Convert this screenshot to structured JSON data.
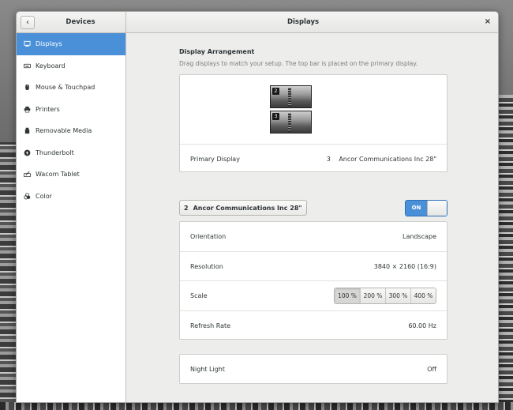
{
  "sidebar": {
    "title": "Devices",
    "back_label": "‹",
    "items": [
      {
        "label": "Displays",
        "icon": "display-icon",
        "active": true
      },
      {
        "label": "Keyboard",
        "icon": "keyboard-icon"
      },
      {
        "label": "Mouse & Touchpad",
        "icon": "mouse-icon"
      },
      {
        "label": "Printers",
        "icon": "printer-icon"
      },
      {
        "label": "Removable Media",
        "icon": "removable-media-icon"
      },
      {
        "label": "Thunderbolt",
        "icon": "thunderbolt-icon"
      },
      {
        "label": "Wacom Tablet",
        "icon": "tablet-icon"
      },
      {
        "label": "Color",
        "icon": "color-icon"
      }
    ]
  },
  "header": {
    "title": "Displays",
    "close_label": "×"
  },
  "arrangement": {
    "title": "Display Arrangement",
    "subtitle": "Drag displays to match your setup. The top bar is placed on the primary display.",
    "monitors": [
      {
        "number": "2"
      },
      {
        "number": "3"
      }
    ],
    "primary_label": "Primary Display",
    "primary_number": "3",
    "primary_name": "Ancor Communications Inc 28\""
  },
  "selected_display": {
    "number": "2",
    "name": "Ancor Communications Inc 28\"",
    "switch_label": "ON",
    "enabled": true
  },
  "settings": {
    "orientation_label": "Orientation",
    "orientation_value": "Landscape",
    "resolution_label": "Resolution",
    "resolution_value": "3840 × 2160 (16:9)",
    "scale_label": "Scale",
    "scale_options": [
      "100 %",
      "200 %",
      "300 %",
      "400 %"
    ],
    "scale_selected": "100 %",
    "refresh_label": "Refresh Rate",
    "refresh_value": "60.00 Hz"
  },
  "night_light": {
    "label": "Night Light",
    "value": "Off"
  },
  "colors": {
    "accent": "#4a90d9",
    "sidebar_bg": "#ffffff",
    "window_bg": "#ededeb"
  }
}
